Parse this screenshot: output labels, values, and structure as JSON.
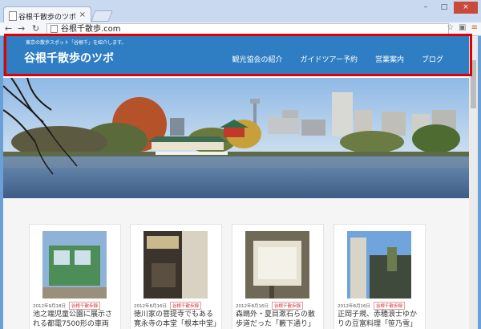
{
  "browser": {
    "tab_title": "谷根千散歩のツボ",
    "url": "谷根千散歩.com"
  },
  "site": {
    "tagline": "東京の散歩スポット「谷根千」を紹介します。",
    "logo": "谷根千散歩のツボ",
    "nav": [
      "観光協会の紹介",
      "ガイドツアー予約",
      "営業案内",
      "ブログ"
    ]
  },
  "posts": [
    {
      "date": "2012年9月18日",
      "tag": "谷根千散歩録",
      "excerpt": "池之端児童公園に展示される都電7500形の車両"
    },
    {
      "date": "2012年8月16日",
      "tag": "谷根千散歩録",
      "excerpt": "徳川家の菩提寺でもある寛永寺の本堂「根本中堂」"
    },
    {
      "date": "2012年8月16日",
      "tag": "谷根千散歩録",
      "excerpt": "森鴎外・夏目漱石らの散歩道だった「藪下通り」"
    },
    {
      "date": "2012年8月16日",
      "tag": "谷根千散歩録",
      "excerpt": "正岡子規、赤穂浪士ゆかりの豆富料理「笹乃雪」"
    }
  ],
  "colors": {
    "header": "#2f7ec4",
    "highlight": "#e00000",
    "badge": "#d03030"
  }
}
